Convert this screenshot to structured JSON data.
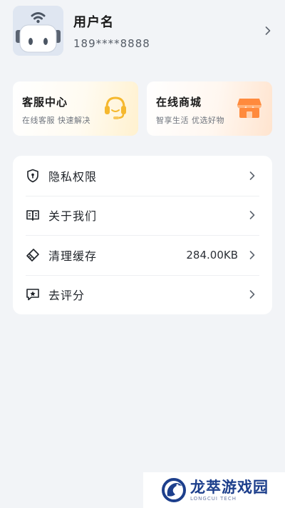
{
  "profile": {
    "username": "用户名",
    "phone": "189****8888"
  },
  "cards": [
    {
      "title": "客服中心",
      "subtitle": "在线客服 快速解决",
      "icon": "headset-icon"
    },
    {
      "title": "在线商城",
      "subtitle": "智享生活 优选好物",
      "icon": "store-icon"
    }
  ],
  "menu": [
    {
      "label": "隐私权限",
      "icon": "shield-lock-icon",
      "value": ""
    },
    {
      "label": "关于我们",
      "icon": "book-icon",
      "value": ""
    },
    {
      "label": "清理缓存",
      "icon": "clean-icon",
      "value": "284.00KB"
    },
    {
      "label": "去评分",
      "icon": "star-comment-icon",
      "value": ""
    }
  ],
  "watermark": {
    "main": "龙萃游戏园",
    "sub": "LONGCUI TECH"
  },
  "colors": {
    "background": "#f2f4f7",
    "service_accent": "#f5b82e",
    "mall_accent": "#ff8a3d",
    "watermark_blue": "#1d3f8c"
  }
}
